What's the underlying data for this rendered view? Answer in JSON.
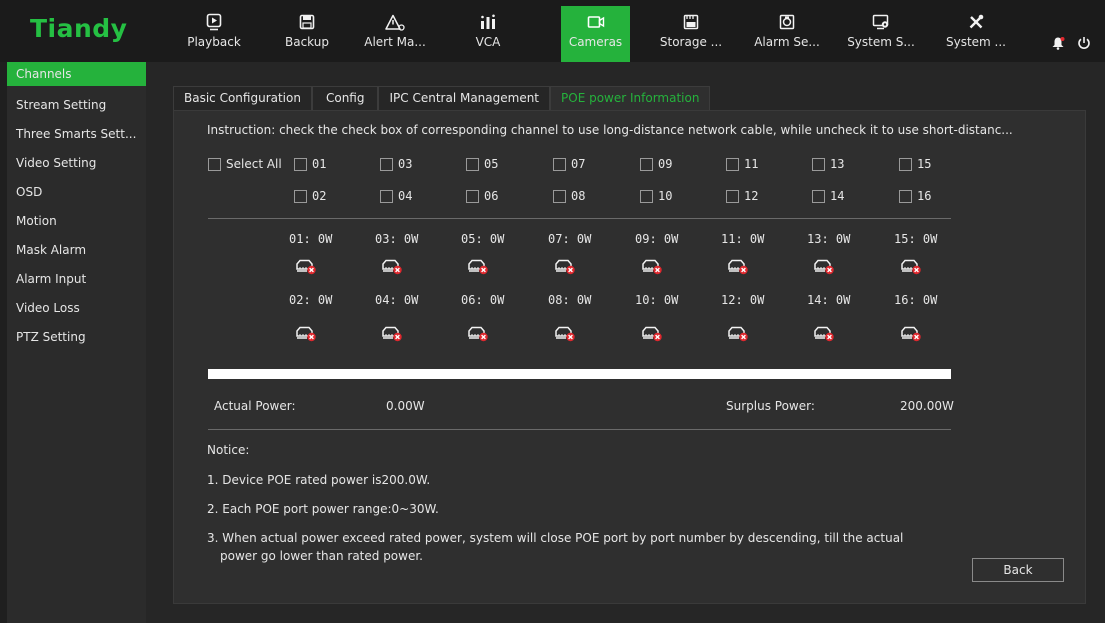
{
  "brand": {
    "logo": "Tiandy"
  },
  "nav": [
    {
      "label": "Playback",
      "icon": "playback-icon",
      "glyph": "▣"
    },
    {
      "label": "Backup",
      "icon": "backup-icon",
      "glyph": "▤"
    },
    {
      "label": "Alert Ma...",
      "icon": "alert-icon",
      "glyph": "⚠"
    },
    {
      "label": "VCA",
      "icon": "vca-icon",
      "glyph": "▓"
    },
    {
      "label": "Cameras",
      "icon": "camera-icon",
      "glyph": "▭"
    },
    {
      "label": "Storage ...",
      "icon": "storage-icon",
      "glyph": "▦"
    },
    {
      "label": "Alarm Se...",
      "icon": "alarm-settings-icon",
      "glyph": "▩"
    },
    {
      "label": "System S...",
      "icon": "system-settings-icon",
      "glyph": "▧"
    },
    {
      "label": "System ...",
      "icon": "system-tools-icon",
      "glyph": "✘"
    }
  ],
  "sidebar": {
    "items": [
      {
        "label": "Channels"
      },
      {
        "label": "Stream Setting"
      },
      {
        "label": "Three Smarts Sett..."
      },
      {
        "label": "Video Setting"
      },
      {
        "label": "OSD"
      },
      {
        "label": "Motion"
      },
      {
        "label": "Mask Alarm"
      },
      {
        "label": "Alarm Input"
      },
      {
        "label": "Video Loss"
      },
      {
        "label": "PTZ Setting"
      }
    ]
  },
  "tabs": [
    {
      "label": "Basic Configuration"
    },
    {
      "label": "Config"
    },
    {
      "label": "IPC Central Management"
    },
    {
      "label": "POE power Information"
    }
  ],
  "instruction": "Instruction: check the check box of corresponding channel to use long-distance network cable, while uncheck it to use short-distanc...",
  "select_all": "Select All",
  "channels_odd": [
    "01",
    "03",
    "05",
    "07",
    "09",
    "11",
    "13",
    "15"
  ],
  "channels_even": [
    "02",
    "04",
    "06",
    "08",
    "10",
    "12",
    "14",
    "16"
  ],
  "power_odd": [
    "01: 0W",
    "03: 0W",
    "05: 0W",
    "07: 0W",
    "09: 0W",
    "11: 0W",
    "13: 0W",
    "15: 0W"
  ],
  "power_even": [
    "02: 0W",
    "04: 0W",
    "06: 0W",
    "08: 0W",
    "10: 0W",
    "12: 0W",
    "14: 0W",
    "16: 0W"
  ],
  "power": {
    "actual_label": "Actual Power:",
    "actual_value": "0.00W",
    "surplus_label": "Surplus Power:",
    "surplus_value": "200.00W"
  },
  "notice": {
    "title": "Notice:",
    "line1": "1. Device POE rated power is200.0W.",
    "line2": "2. Each POE port power range:0~30W.",
    "line3a": "3. When actual power exceed rated power, system will close POE port by port number by descending, till the actual",
    "line3b": "power go lower than rated power."
  },
  "buttons": {
    "back": "Back"
  },
  "colors": {
    "accent": "#25b23c",
    "logo": "#25c043",
    "alert_red": "#e0282e"
  }
}
